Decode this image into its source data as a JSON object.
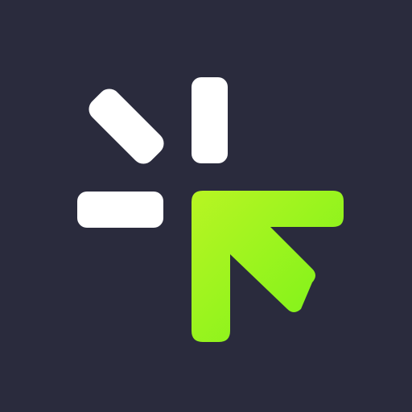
{
  "icon": {
    "name": "app-icon-cursor-click",
    "colors": {
      "background": "#2a2b3d",
      "rays": "#ffffff",
      "arrow_start": "#b8f523",
      "arrow_end": "#78f219"
    }
  }
}
